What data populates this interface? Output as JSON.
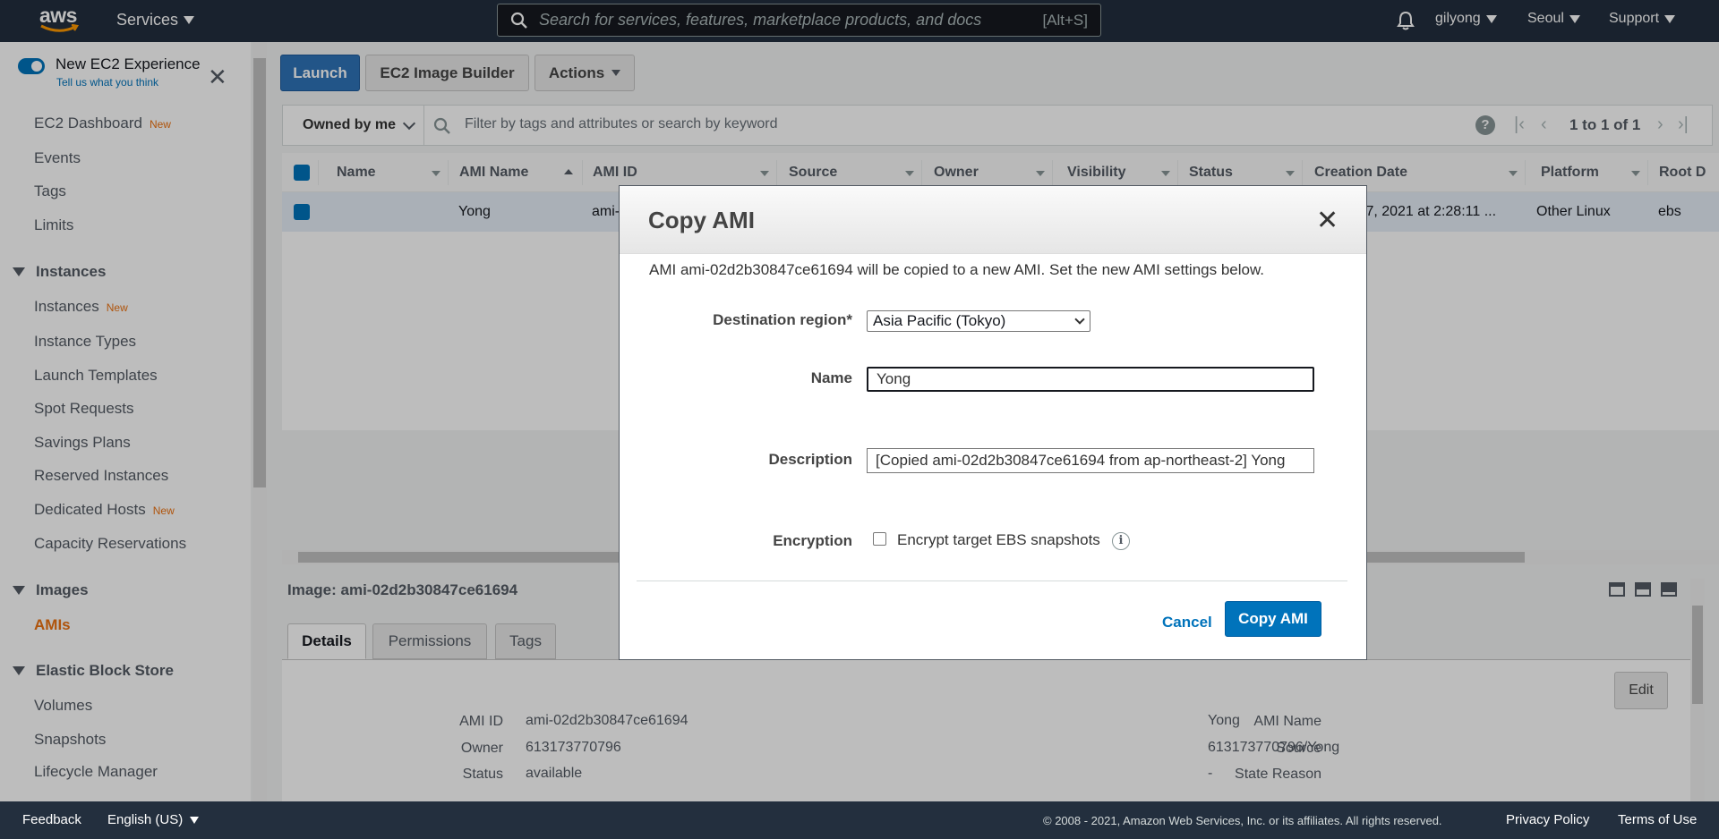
{
  "topnav": {
    "logo_text": "aws",
    "services_label": "Services",
    "search_placeholder": "Search for services, features, marketplace products, and docs",
    "search_shortcut": "[Alt+S]",
    "user": "gilyong",
    "region": "Seoul",
    "support": "Support"
  },
  "sidebar": {
    "new_experience": "New EC2 Experience",
    "tell_us": "Tell us what you think",
    "new_badge": "New",
    "dashboard": "EC2 Dashboard",
    "events": "Events",
    "tags": "Tags",
    "limits": "Limits",
    "sections": [
      {
        "label": "Instances",
        "items": [
          "Instances",
          "Instance Types",
          "Launch Templates",
          "Spot Requests",
          "Savings Plans",
          "Reserved Instances",
          "Dedicated Hosts",
          "Capacity Reservations"
        ]
      },
      {
        "label": "Images",
        "items": [
          "AMIs"
        ]
      },
      {
        "label": "Elastic Block Store",
        "items": [
          "Volumes",
          "Snapshots",
          "Lifecycle Manager"
        ]
      }
    ]
  },
  "toolbar": {
    "launch": "Launch",
    "image_builder": "EC2 Image Builder",
    "actions": "Actions"
  },
  "filter": {
    "owned_by": "Owned by me",
    "placeholder": "Filter by tags and attributes or search by keyword",
    "help": "?",
    "pager": "1 to 1 of 1"
  },
  "table": {
    "columns": [
      "Name",
      "AMI Name",
      "AMI ID",
      "Source",
      "Owner",
      "Visibility",
      "Status",
      "Creation Date",
      "Platform",
      "Root D"
    ],
    "row": {
      "ami_name": "Yong",
      "ami_id": "ami-",
      "creation_date": "y 7, 2021 at 2:28:11 ...",
      "platform": "Other Linux",
      "root": "ebs"
    }
  },
  "detail": {
    "title": "Image: ami-02d2b30847ce61694",
    "tabs": [
      "Details",
      "Permissions",
      "Tags"
    ],
    "edit": "Edit",
    "left": [
      {
        "k": "AMI ID",
        "v": "ami-02d2b30847ce61694"
      },
      {
        "k": "Owner",
        "v": "613173770796"
      },
      {
        "k": "Status",
        "v": "available"
      }
    ],
    "right": [
      {
        "k": "AMI Name",
        "v": "Yong"
      },
      {
        "k": "Source",
        "v": "613173770796/Yong"
      },
      {
        "k": "State Reason",
        "v": "-"
      }
    ]
  },
  "modal": {
    "title": "Copy AMI",
    "close": "✕",
    "info": "AMI ami-02d2b30847ce61694 will be copied to a new AMI. Set the new AMI settings below.",
    "dest_label": "Destination region*",
    "dest_value": "Asia Pacific (Tokyo)",
    "name_label": "Name",
    "name_value": "Yong",
    "desc_label": "Description",
    "desc_value": "[Copied ami-02d2b30847ce61694 from ap-northeast-2] Yong",
    "enc_label": "Encryption",
    "enc_checkbox": "Encrypt target EBS snapshots",
    "enc_checked": false,
    "cancel": "Cancel",
    "submit": "Copy AMI"
  },
  "footer": {
    "feedback": "Feedback",
    "language": "English (US)",
    "copyright": "© 2008 - 2021, Amazon Web Services, Inc. or its affiliates. All rights reserved.",
    "privacy": "Privacy Policy",
    "terms": "Terms of Use"
  },
  "colors": {
    "nav": "#232f3e",
    "accent": "#ec7211",
    "primary": "#0073bb"
  }
}
